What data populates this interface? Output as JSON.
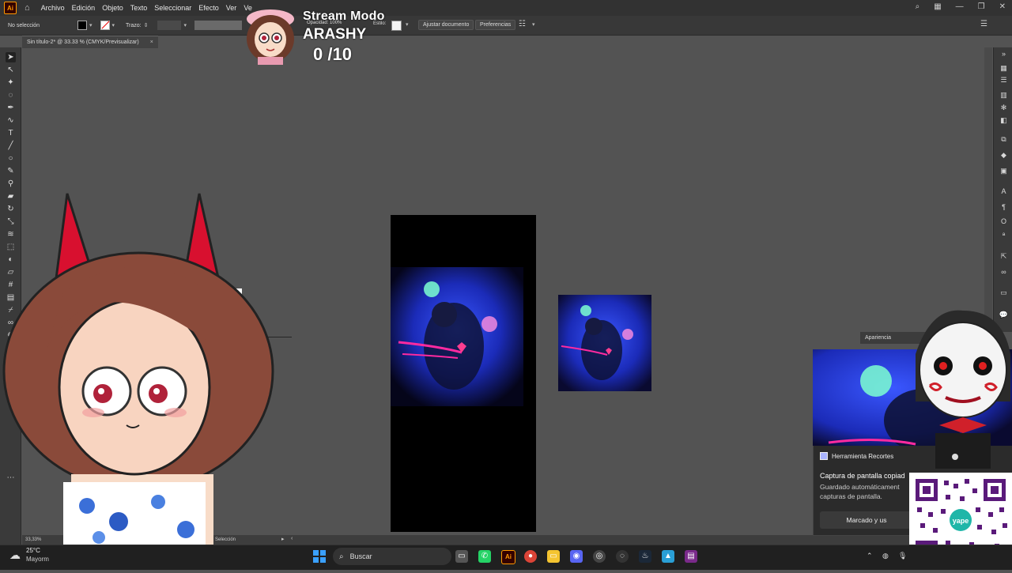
{
  "menubar": {
    "app_badge": "Ai",
    "items": [
      "Archivo",
      "Edición",
      "Objeto",
      "Texto",
      "Seleccionar",
      "Efecto",
      "Ver",
      "Ve"
    ]
  },
  "controlbar": {
    "selection_label": "No selección",
    "stroke_label": "Trazo:",
    "opacity_label": "Opacidad: 100%",
    "style_label": "Estilo:",
    "fit_document_button": "Ajustar documento",
    "preferences_button": "Preferencias"
  },
  "document": {
    "tab_title": "Sin título-2* @ 33.33 % (CMYK/Previsualizar)",
    "close_glyph": "×"
  },
  "status": {
    "zoom": "33,33%",
    "tool_name": "Selección"
  },
  "stream": {
    "title": "Stream Modo",
    "name": "ARASHY",
    "counter": "0  /10"
  },
  "appearance_panel": {
    "tab_label": "Apariencia"
  },
  "notification": {
    "app_name": "Herramienta Recortes",
    "heading": "Captura de pantalla copiad",
    "body": "Guardado automáticament capturas de pantalla.",
    "button": "Marcado y us"
  },
  "taskbar": {
    "temperature": "25°C",
    "weather": "Mayorm",
    "search_placeholder": "Buscar"
  },
  "colors": {
    "app_bg": "#535353",
    "panel_bg": "#3a3a3a",
    "menubar_bg": "#323232",
    "taskbar_bg": "#202020",
    "illustrator_orange": "#ff9a00"
  },
  "qr_brand": "yape"
}
